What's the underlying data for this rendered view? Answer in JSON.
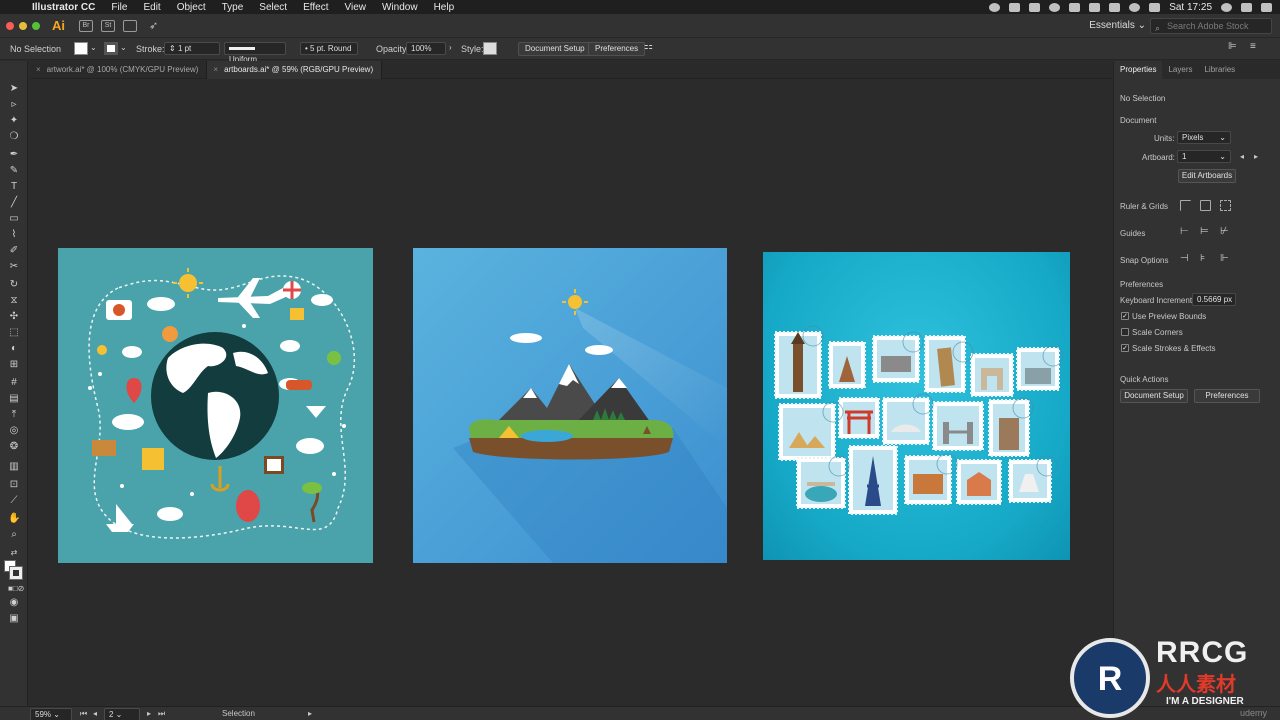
{
  "menubar": {
    "app_name": "Illustrator CC",
    "items": [
      "File",
      "Edit",
      "Object",
      "Type",
      "Select",
      "Effect",
      "View",
      "Window",
      "Help"
    ],
    "clock": "Sat 17:25"
  },
  "appbar": {
    "logo": "Ai",
    "bridge": "Br",
    "stock": "St",
    "workspace": "Essentials",
    "search_placeholder": "Search Adobe Stock"
  },
  "control_bar": {
    "selection": "No Selection",
    "stroke_label": "Stroke:",
    "stroke_value": "1 pt",
    "stroke_profile": "Uniform",
    "brush": "5 pt. Round",
    "opacity_label": "Opacity:",
    "opacity_value": "100%",
    "style_label": "Style:",
    "document_setup": "Document Setup",
    "preferences": "Preferences"
  },
  "tabs": [
    {
      "label": "artwork.ai* @ 100% (CMYK/GPU Preview)",
      "active": false
    },
    {
      "label": "artboards.ai* @ 59% (RGB/GPU Preview)",
      "active": true
    }
  ],
  "panel": {
    "tabs": [
      "Properties",
      "Layers",
      "Libraries"
    ],
    "no_selection": "No Selection",
    "document_heading": "Document",
    "units_label": "Units:",
    "units_value": "Pixels",
    "artboard_label": "Artboard:",
    "artboard_value": "1",
    "edit_artboards": "Edit Artboards",
    "ruler_grids": "Ruler & Grids",
    "guides": "Guides",
    "snap_options": "Snap Options",
    "preferences_heading": "Preferences",
    "keyboard_increment_label": "Keyboard Increment:",
    "keyboard_increment_value": "0.5669 px",
    "use_preview_bounds": "Use Preview Bounds",
    "scale_corners": "Scale Corners",
    "scale_strokes_effects": "Scale Strokes & Effects",
    "quick_actions": "Quick Actions",
    "document_setup": "Document Setup",
    "preferences_button": "Preferences"
  },
  "status": {
    "zoom": "59%",
    "artboard_number": "2",
    "tool": "Selection"
  },
  "watermark": {
    "brand": "RRCG",
    "chinese": "人人素材",
    "tagline": "I'M A DESIGNER",
    "small": "udemy"
  },
  "colors": {
    "artboard1": "#4aa2aa",
    "artboard2": "#4aa5dc",
    "artboard3": "#19adc9",
    "accent": "#f6a623"
  }
}
